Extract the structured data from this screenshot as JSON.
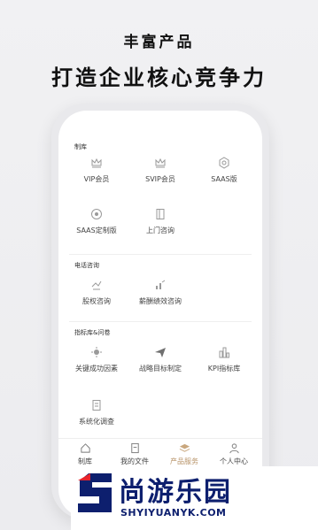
{
  "header": {
    "subtitle": "丰富产品",
    "title": "打造企业核心竞争力"
  },
  "sections": [
    {
      "title": "制库",
      "items": [
        {
          "label": "VIP会员",
          "icon": "crown-icon"
        },
        {
          "label": "SVIP会员",
          "icon": "crown-icon"
        },
        {
          "label": "SAAS版",
          "icon": "hexagon-icon"
        },
        {
          "label": "SAAS定制版",
          "icon": "custom-gear-icon"
        },
        {
          "label": "上门咨询",
          "icon": "door-icon"
        }
      ]
    },
    {
      "title": "电话咨询",
      "items": [
        {
          "label": "股权咨询",
          "icon": "equity-icon"
        },
        {
          "label": "薪酬绩效咨询",
          "icon": "salary-icon"
        }
      ]
    },
    {
      "title": "指标库&问卷",
      "items": [
        {
          "label": "关键成功因素",
          "icon": "key-factor-icon"
        },
        {
          "label": "战略目标制定",
          "icon": "paper-plane-icon"
        },
        {
          "label": "KPI指标库",
          "icon": "kpi-icon"
        },
        {
          "label": "系统化调查",
          "icon": "document-icon"
        }
      ]
    }
  ],
  "tabbar": [
    {
      "label": "制库",
      "icon": "home-icon",
      "active": false
    },
    {
      "label": "我的文件",
      "icon": "file-icon",
      "active": false
    },
    {
      "label": "产品服务",
      "icon": "layers-icon",
      "active": true
    },
    {
      "label": "个人中心",
      "icon": "user-icon",
      "active": false
    }
  ],
  "watermark": {
    "name": "尚游乐园",
    "url": "SHYIYUANYK.COM"
  },
  "colors": {
    "accent": "#b8946a",
    "text": "#222222",
    "icon": "#9a9a9a",
    "watermark": "#0d1f6e",
    "watermark_red": "#e8232a"
  }
}
